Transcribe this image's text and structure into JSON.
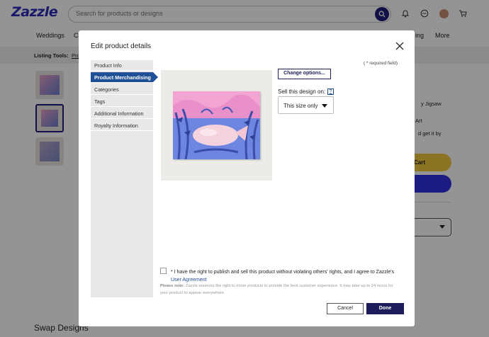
{
  "header": {
    "logo": "Zazzle",
    "search_placeholder": "Search for products or designs",
    "icons": [
      "search-icon",
      "bell-icon",
      "chat-icon",
      "avatar",
      "cart-icon"
    ]
  },
  "nav": {
    "items": [
      "Weddings",
      "C",
      "ing",
      "More"
    ]
  },
  "tools_bar": {
    "label": "Listing Tools:",
    "link": "Pro"
  },
  "background_product": {
    "text_lines": [
      "y Jigsaw",
      "Art",
      "d get it by"
    ],
    "cart_label": "Cart"
  },
  "swap_designs": "Swap Designs",
  "modal": {
    "title": "Edit product details",
    "required_note": "( * required field)",
    "sidenav": [
      {
        "label": "Product Info",
        "active": false
      },
      {
        "label": "Product Merchandising",
        "active": true
      },
      {
        "label": "Categories",
        "active": false
      },
      {
        "label": "Tags",
        "active": false
      },
      {
        "label": "Additional Information",
        "active": false
      },
      {
        "label": "Royalty Information",
        "active": false
      }
    ],
    "change_options": "Change options...",
    "sell_label": "Sell this design on:",
    "help": "?",
    "sell_select": "This size only",
    "agree_text": "* I have the right to publish and sell this product without violating others' rights, and I agree to Zazzle's",
    "agree_link": "User Agreement",
    "note_label": "Please note:",
    "note_text": "Zazzle reserves the right to move products to provide the best customer experience. It may take up to 24 hours for your product to appear everywhere.",
    "cancel": "Cancel",
    "done": "Done"
  },
  "colors": {
    "brand": "#2c2cb8",
    "active_tab": "#1f4f96",
    "done_button": "#1c1c5a",
    "cart_button": "#f3c73e"
  }
}
